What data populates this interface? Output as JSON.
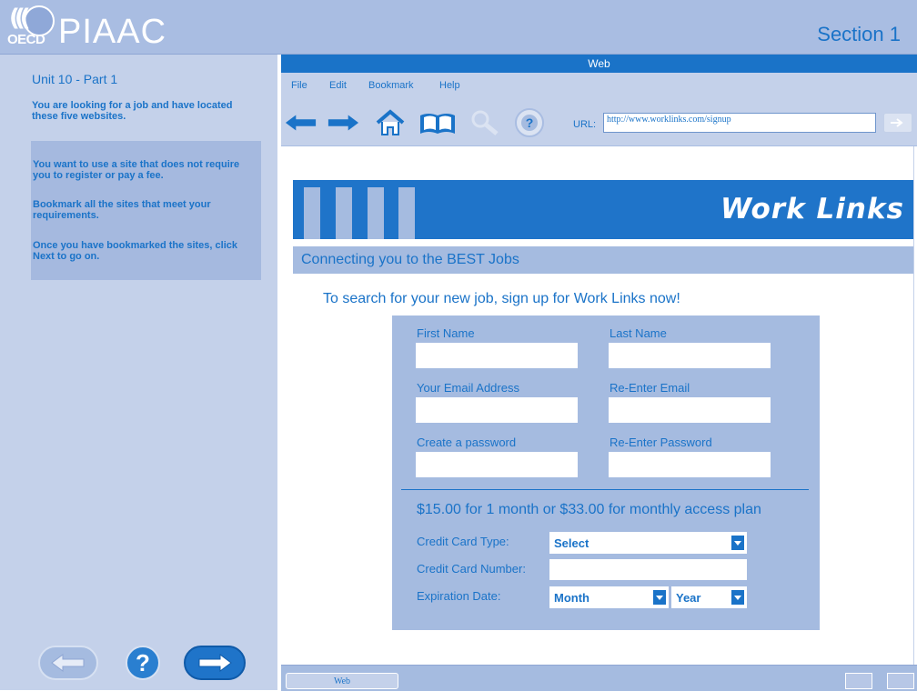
{
  "header": {
    "logo_small": "OECD",
    "logo_name": "PIAAC",
    "section": "Section 1"
  },
  "left": {
    "unit_title": "Unit 10 - Part 1",
    "intro": "You are looking for a job and have located these five websites.",
    "task_1": "You want to use a site that does not require you to register or pay a fee.",
    "task_2": "Bookmark all the sites that meet your requirements.",
    "task_3": "Once you have bookmarked the sites, click Next to go on.",
    "help_symbol": "?"
  },
  "browser": {
    "title": "Web",
    "menu": [
      "File",
      "Edit",
      "Bookmark",
      "Help"
    ],
    "url_label": "URL:",
    "url": "http://www.worklinks.com/signup",
    "status_tab": "Web"
  },
  "page": {
    "brand": "Work Links",
    "tagline": "Connecting you to the BEST Jobs",
    "lead": "To search for your new job, sign up for Work Links now!",
    "form": {
      "first_name": "First Name",
      "last_name": "Last Name",
      "email": "Your Email Address",
      "reenter_email": "Re-Enter Email",
      "password": "Create a password",
      "reenter_password": "Re-Enter Password",
      "price": "$15.00 for 1 month or $33.00 for monthly access plan",
      "card_type_label": "Credit Card Type:",
      "card_type_value": "Select",
      "card_number_label": "Credit Card Number:",
      "expiration_label": "Expiration Date:",
      "month_value": "Month",
      "year_value": "Year"
    }
  },
  "colors": {
    "accent": "#1a73c8",
    "panel": "#c4d1ea",
    "light_panel": "#a5bbe0"
  },
  "icons": [
    "back-arrow-icon",
    "forward-arrow-icon",
    "home-icon",
    "book-icon",
    "search-icon",
    "help-icon",
    "go-icon"
  ]
}
